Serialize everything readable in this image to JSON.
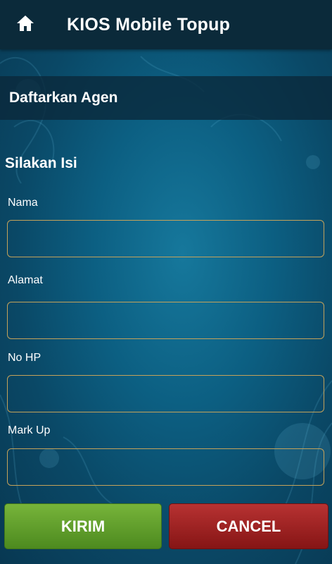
{
  "appbar": {
    "title": "KIOS Mobile Topup",
    "home_icon": "home-icon"
  },
  "section": {
    "title": "Daftarkan Agen"
  },
  "form": {
    "heading": "Silakan Isi",
    "fields": [
      {
        "label": "Nama",
        "value": "",
        "placeholder": ""
      },
      {
        "label": "Alamat",
        "value": "",
        "placeholder": ""
      },
      {
        "label": "No HP",
        "value": "",
        "placeholder": ""
      },
      {
        "label": "Mark Up",
        "value": "",
        "placeholder": ""
      }
    ]
  },
  "buttons": {
    "submit_label": "KIRIM",
    "cancel_label": "CANCEL"
  },
  "colors": {
    "appbar": "#0b2a3a",
    "input_border": "#c4a25a",
    "submit": "#5f9f2a",
    "cancel": "#a02222"
  }
}
